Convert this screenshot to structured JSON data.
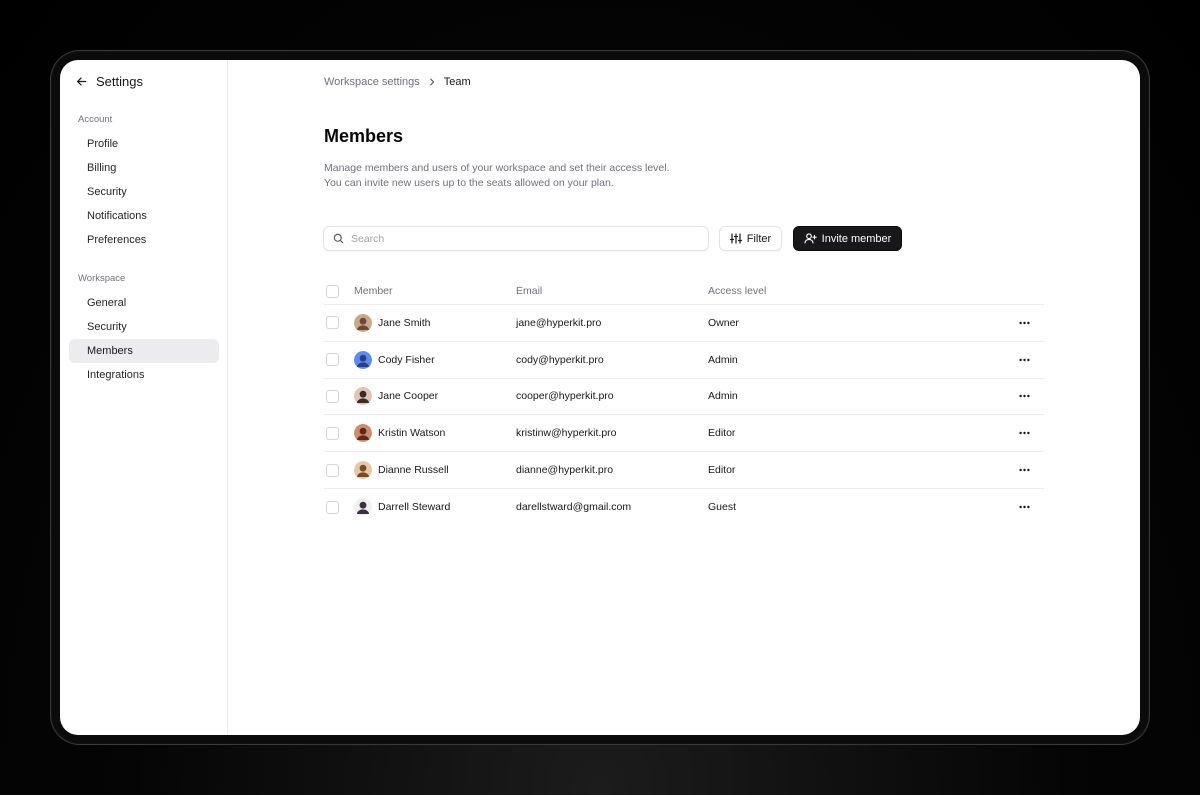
{
  "sidebar": {
    "title": "Settings",
    "sections": [
      {
        "label": "Account",
        "items": [
          {
            "label": "Profile",
            "active": false
          },
          {
            "label": "Billing",
            "active": false
          },
          {
            "label": "Security",
            "active": false
          },
          {
            "label": "Notifications",
            "active": false
          },
          {
            "label": "Preferences",
            "active": false
          }
        ]
      },
      {
        "label": "Workspace",
        "items": [
          {
            "label": "General",
            "active": false
          },
          {
            "label": "Security",
            "active": false
          },
          {
            "label": "Members",
            "active": true
          },
          {
            "label": "Integrations",
            "active": false
          }
        ]
      }
    ]
  },
  "breadcrumb": {
    "parent": "Workspace settings",
    "current": "Team"
  },
  "page": {
    "title": "Members",
    "description_line1": "Manage members and users of your workspace and set their access level.",
    "description_line2": "You can invite new users up to the seats allowed on your plan."
  },
  "toolbar": {
    "search_placeholder": "Search",
    "search_value": "",
    "filter_label": "Filter",
    "invite_label": "Invite member"
  },
  "table": {
    "headers": {
      "member": "Member",
      "email": "Email",
      "access": "Access level"
    },
    "rows": [
      {
        "name": "Jane Smith",
        "email": "jane@hyperkit.pro",
        "access": "Owner",
        "avatar_colors": [
          "#c9a88a",
          "#6b4a3a"
        ]
      },
      {
        "name": "Cody Fisher",
        "email": "cody@hyperkit.pro",
        "access": "Admin",
        "avatar_colors": [
          "#5b8def",
          "#2d3e8f"
        ]
      },
      {
        "name": "Jane Cooper",
        "email": "cooper@hyperkit.pro",
        "access": "Admin",
        "avatar_colors": [
          "#e0c4b4",
          "#3a2a2a"
        ]
      },
      {
        "name": "Kristin Watson",
        "email": "kristinw@hyperkit.pro",
        "access": "Editor",
        "avatar_colors": [
          "#d08a6a",
          "#5a2a1a"
        ]
      },
      {
        "name": "Dianne Russell",
        "email": "dianne@hyperkit.pro",
        "access": "Editor",
        "avatar_colors": [
          "#e8c8a0",
          "#7a4a2a"
        ]
      },
      {
        "name": "Darrell Steward",
        "email": "darellstward@gmail.com",
        "access": "Guest",
        "avatar_colors": [
          "#f0f0f0",
          "#3a3040"
        ]
      }
    ]
  },
  "colors": {
    "accent_dark": "#18181b",
    "active_bg": "#ececee",
    "muted_text": "#71717a"
  }
}
